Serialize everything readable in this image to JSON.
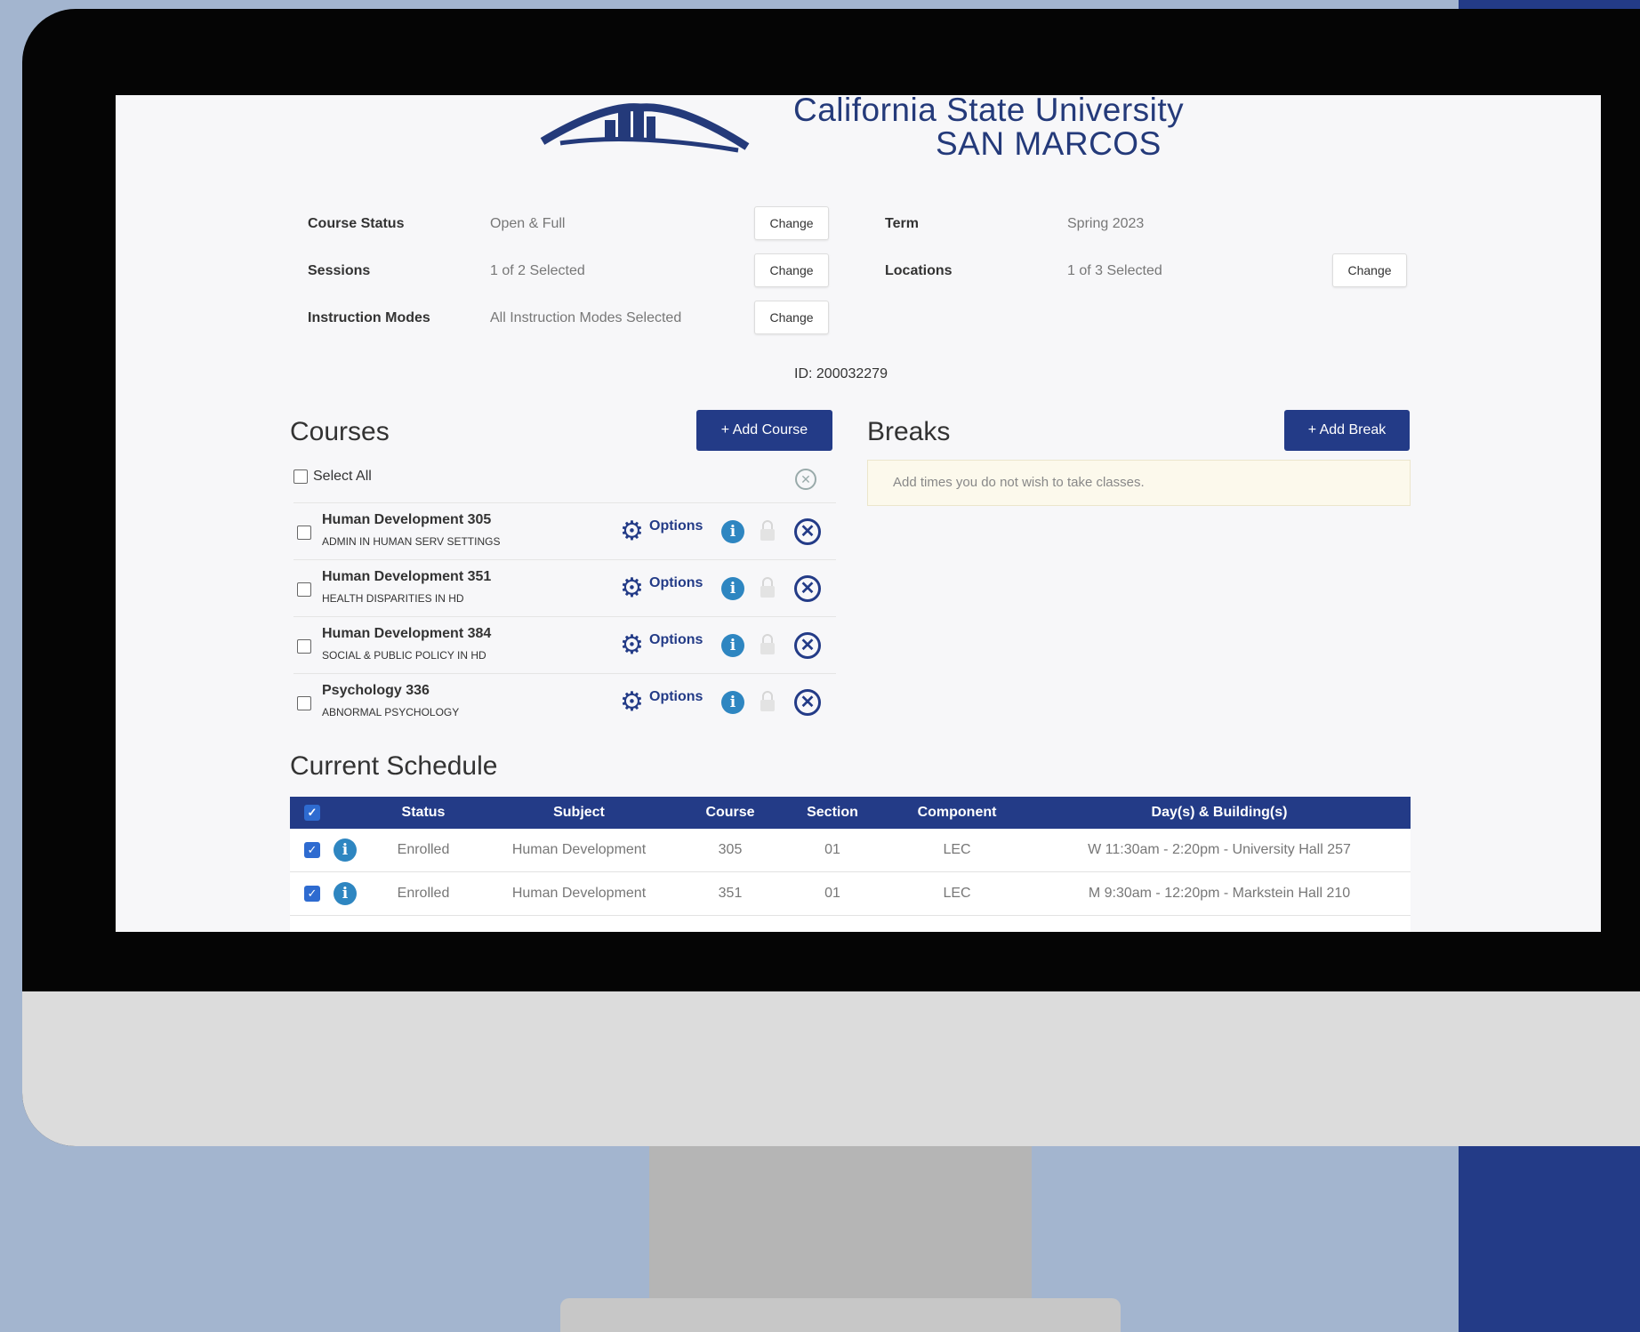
{
  "logo": {
    "line1": "California State University",
    "line2": "SAN MARCOS"
  },
  "filters": {
    "course_status": {
      "label": "Course Status",
      "value": "Open & Full",
      "button": "Change"
    },
    "term": {
      "label": "Term",
      "value": "Spring 2023"
    },
    "sessions": {
      "label": "Sessions",
      "value": "1 of 2 Selected",
      "button": "Change"
    },
    "locations": {
      "label": "Locations",
      "value": "1 of 3 Selected",
      "button": "Change"
    },
    "instruction_modes": {
      "label": "Instruction Modes",
      "value": "All Instruction Modes Selected",
      "button": "Change"
    }
  },
  "student_id": "ID: 200032279",
  "courses": {
    "title": "Courses",
    "add_button": "+ Add Course",
    "select_all": "Select All",
    "options_label": "Options",
    "items": [
      {
        "title": "Human Development 305",
        "subtitle": "ADMIN IN HUMAN SERV SETTINGS"
      },
      {
        "title": "Human Development 351",
        "subtitle": "HEALTH DISPARITIES IN HD"
      },
      {
        "title": "Human Development 384",
        "subtitle": "SOCIAL & PUBLIC POLICY IN HD"
      },
      {
        "title": "Psychology 336",
        "subtitle": "ABNORMAL PSYCHOLOGY"
      }
    ]
  },
  "breaks": {
    "title": "Breaks",
    "add_button": "+ Add Break",
    "note": "Add times you do not wish to take classes."
  },
  "schedule": {
    "title": "Current Schedule",
    "columns": [
      "Status",
      "Subject",
      "Course",
      "Section",
      "Component",
      "Day(s) & Building(s)"
    ],
    "rows": [
      {
        "status": "Enrolled",
        "subject": "Human Development",
        "course": "305",
        "section": "01",
        "component": "LEC",
        "days": "W 11:30am - 2:20pm - University Hall 257"
      },
      {
        "status": "Enrolled",
        "subject": "Human Development",
        "course": "351",
        "section": "01",
        "component": "LEC",
        "days": "M 9:30am - 12:20pm - Markstein Hall 210"
      }
    ]
  },
  "colors": {
    "brand_navy": "#233b87",
    "info_blue": "#2e86c1",
    "background": "#a3b5cf"
  },
  "icons": [
    "logo-mountain-icon",
    "checkbox-icon",
    "clear-circle-icon",
    "gear-icon",
    "info-icon",
    "lock-icon",
    "remove-circle-icon",
    "checkmark-icon"
  ]
}
